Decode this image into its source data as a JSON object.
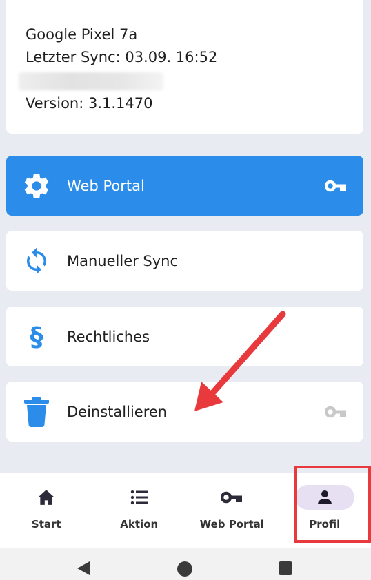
{
  "device_info": {
    "device_name": "Google Pixel 7a",
    "last_sync": "Letzter Sync: 03.09. 16:52",
    "version": "Version: 3.1.1470"
  },
  "menu": {
    "web_portal": "Web Portal",
    "manual_sync": "Manueller Sync",
    "legal": "Rechtliches",
    "legal_symbol": "§",
    "uninstall": "Deinstallieren"
  },
  "bottom_nav": {
    "start": "Start",
    "action": "Aktion",
    "web_portal": "Web Portal",
    "profile": "Profil",
    "active": "Profil"
  },
  "colors": {
    "accent": "#2b8de9",
    "annotation": "#e8393d",
    "active_tab_bg": "#e7dff2"
  },
  "icons": [
    "gear-icon",
    "key-icon",
    "sync-icon",
    "paragraph-icon",
    "trash-icon",
    "home-icon",
    "list-icon",
    "person-icon",
    "back-icon",
    "home-circle-icon",
    "recents-icon"
  ]
}
